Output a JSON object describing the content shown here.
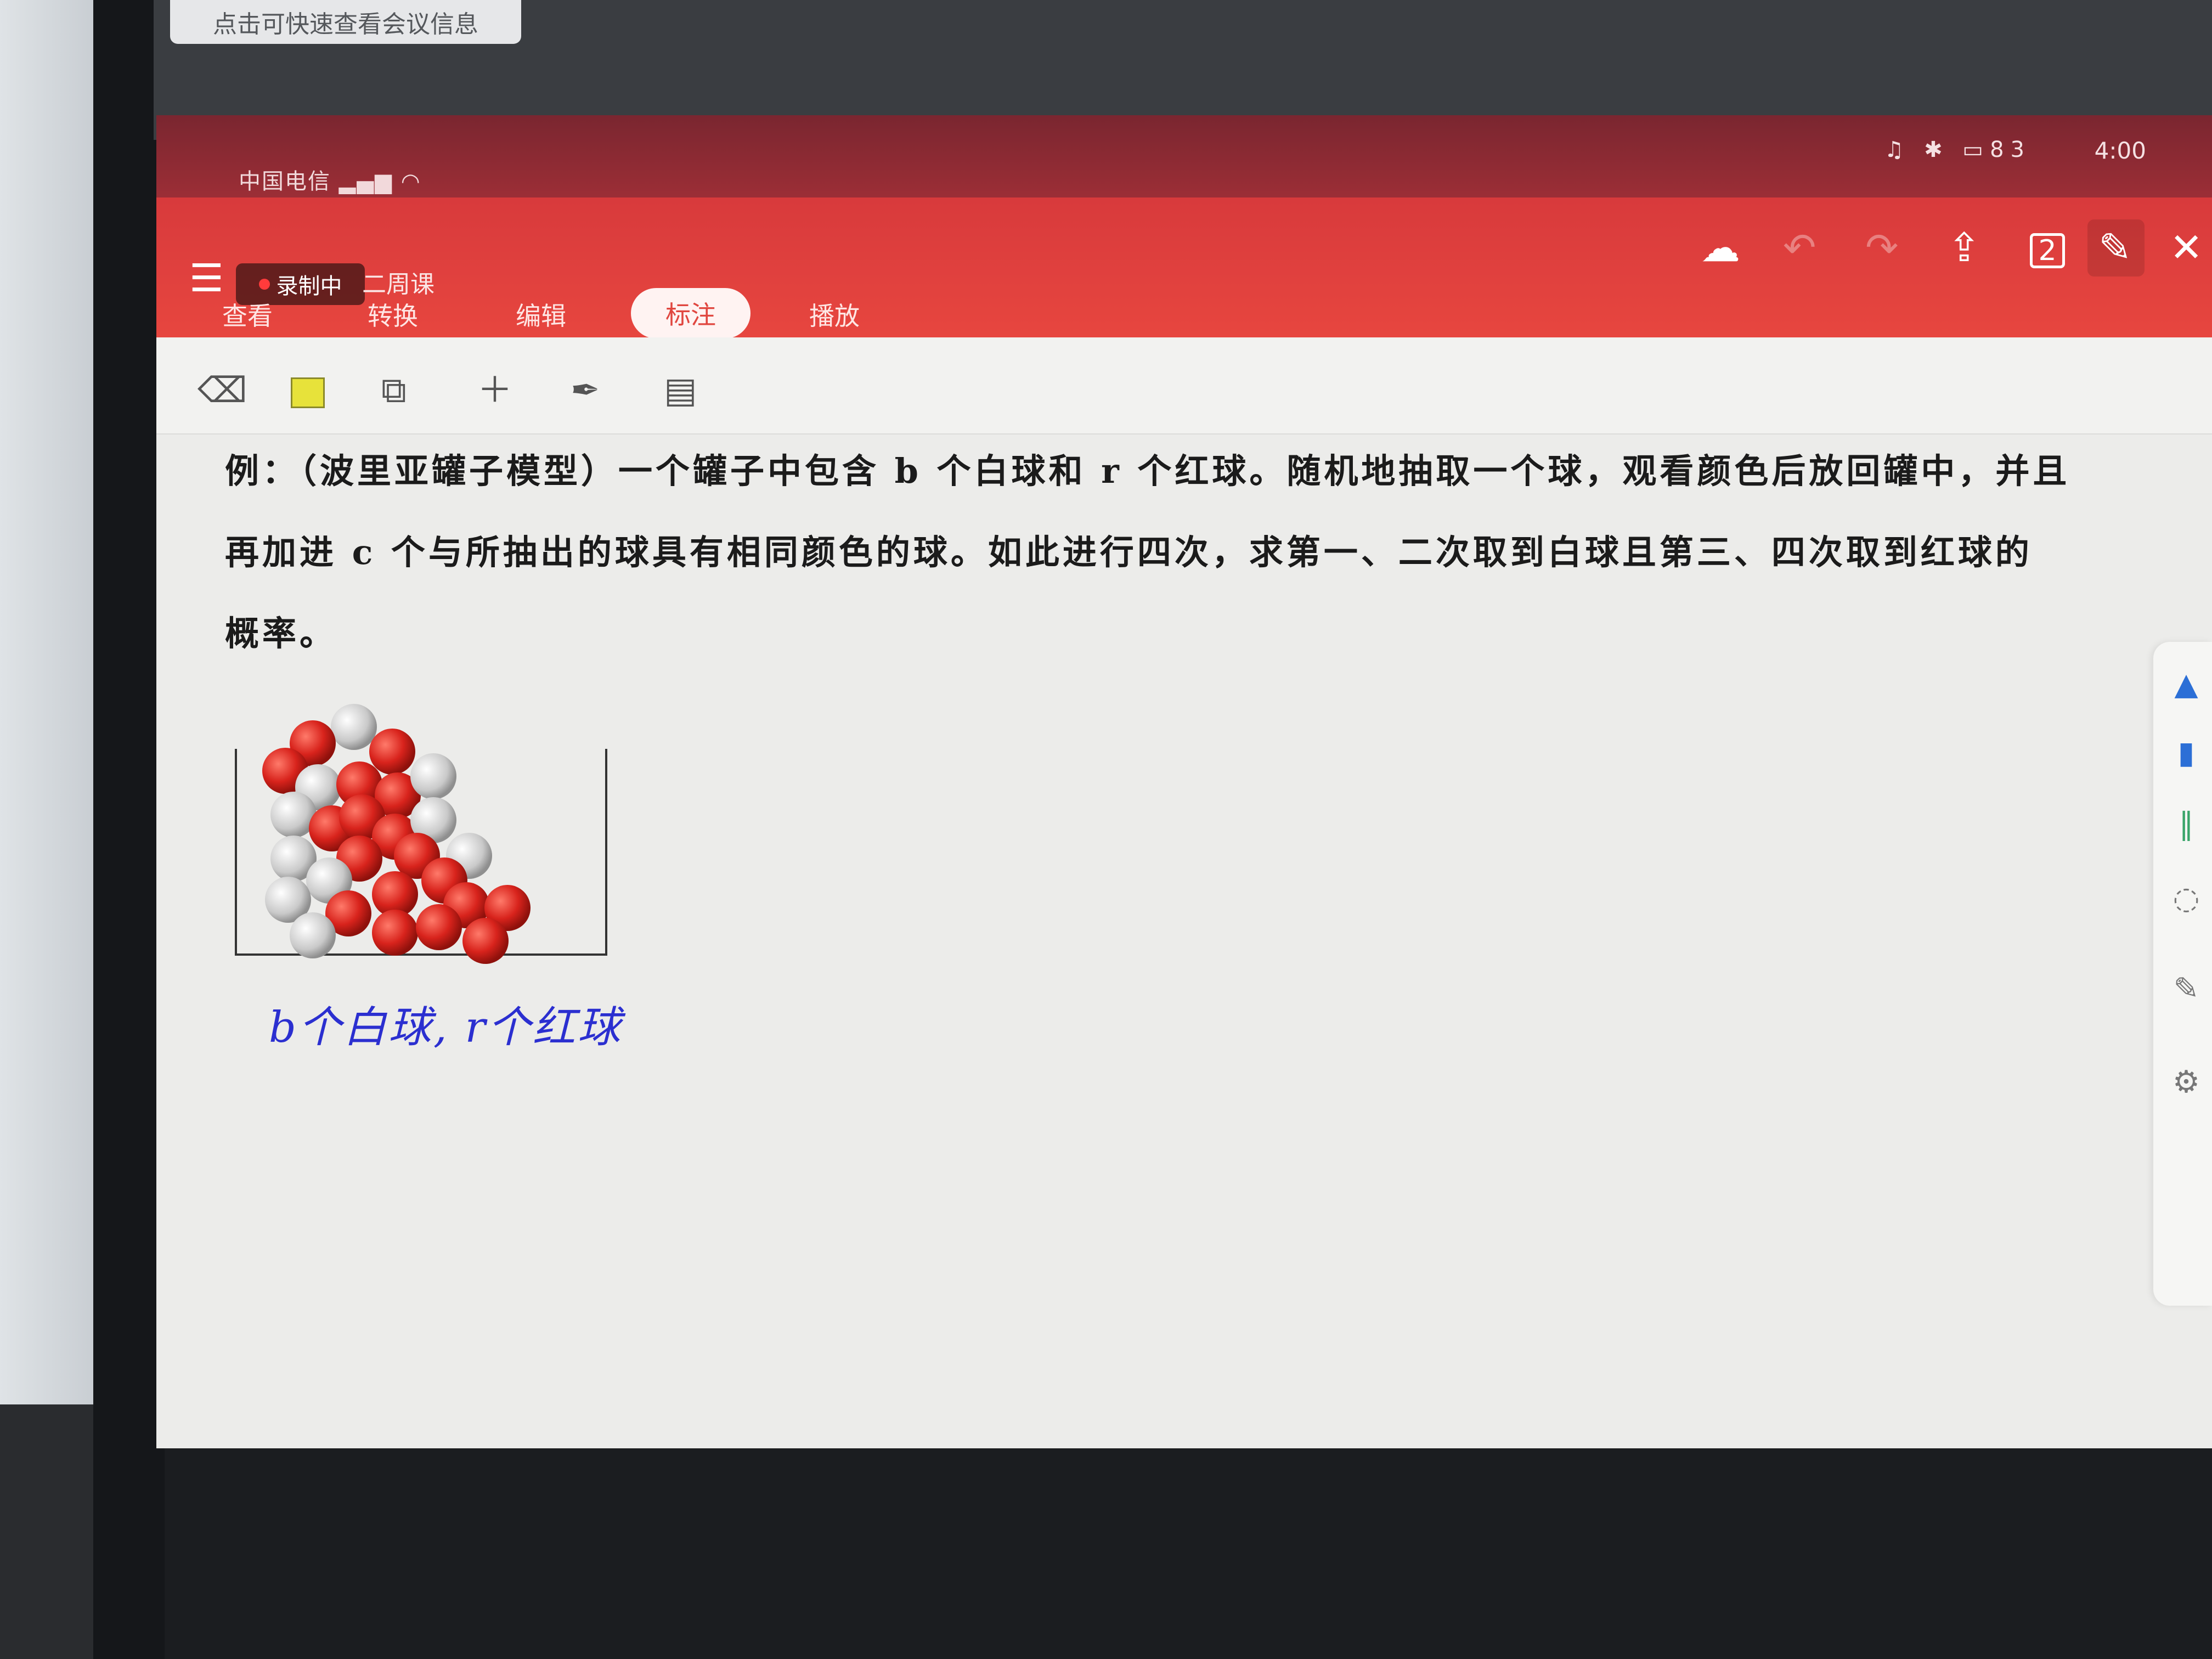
{
  "top_chip": "点击可快速查看会议信息",
  "status_bar": {
    "carrier": "中国电信",
    "time": "4:00",
    "battery": "83"
  },
  "header": {
    "record_badge": "录制中",
    "doc_title": "二周课",
    "tabs": [
      {
        "label": "查看"
      },
      {
        "label": "转换"
      },
      {
        "label": "编辑"
      },
      {
        "label": "标注",
        "active": true
      },
      {
        "label": "播放"
      }
    ],
    "page_count": "2",
    "accent_color": "#e2433e"
  },
  "content": {
    "question_lines": [
      "例：（波里亚罐子模型）一个罐子中包含 b 个白球和 r 个红球。随机地抽取一个球，观看颜色后放回罐中，并且",
      "再加进  c 个与所抽出的球具有相同颜色的球。如此进行四次，求第一、二次取到白球且第三、四次取到红球的",
      "概率。"
    ],
    "caption": "b个白球, r个红球"
  },
  "icons": {
    "menu": "menu-icon",
    "cloud": "cloud-sync-icon",
    "undo": "undo-icon",
    "redo": "redo-icon",
    "share": "share-icon",
    "edit": "pen-edit-icon",
    "close": "close-icon"
  }
}
